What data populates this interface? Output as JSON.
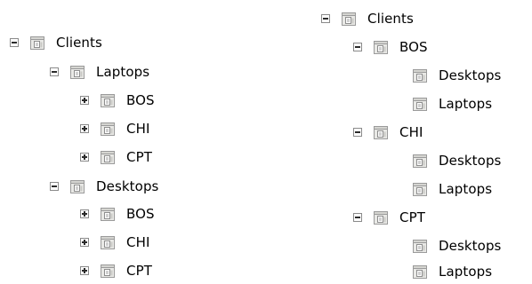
{
  "left_tree": {
    "root": {
      "label": "Clients",
      "toggle": "minus"
    },
    "groups": [
      {
        "label": "Laptops",
        "toggle": "minus",
        "children": [
          {
            "label": "BOS",
            "toggle": "plus"
          },
          {
            "label": "CHI",
            "toggle": "plus"
          },
          {
            "label": "CPT",
            "toggle": "plus"
          }
        ]
      },
      {
        "label": "Desktops",
        "toggle": "minus",
        "children": [
          {
            "label": "BOS",
            "toggle": "plus"
          },
          {
            "label": "CHI",
            "toggle": "plus"
          },
          {
            "label": "CPT",
            "toggle": "plus"
          }
        ]
      }
    ]
  },
  "right_tree": {
    "root": {
      "label": "Clients",
      "toggle": "minus"
    },
    "groups": [
      {
        "label": "BOS",
        "toggle": "minus",
        "children": [
          {
            "label": "Desktops"
          },
          {
            "label": "Laptops"
          }
        ]
      },
      {
        "label": "CHI",
        "toggle": "minus",
        "children": [
          {
            "label": "Desktops"
          },
          {
            "label": "Laptops"
          }
        ]
      },
      {
        "label": "CPT",
        "toggle": "minus",
        "children": [
          {
            "label": "Desktops"
          },
          {
            "label": "Laptops"
          }
        ]
      }
    ]
  },
  "colors": {
    "toggle_border": "#8a8a8a",
    "icon_body": "#e9e9e6",
    "icon_outline": "#9a9a9a"
  }
}
